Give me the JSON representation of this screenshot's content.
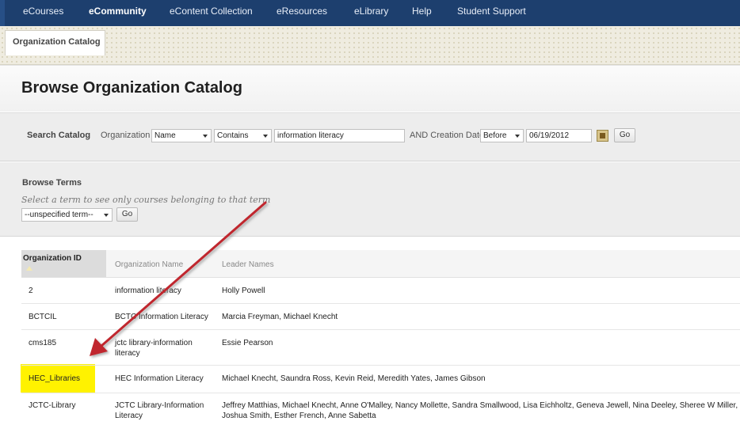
{
  "nav": {
    "tabs": [
      "eCourses",
      "eCommunity",
      "eContent Collection",
      "eResources",
      "eLibrary",
      "Help",
      "Student Support"
    ],
    "active": "eCommunity"
  },
  "breadcrumb": {
    "tab": "Organization Catalog"
  },
  "page_title": "Browse Organization Catalog",
  "search": {
    "label": "Search Catalog",
    "field_label": "Organization",
    "field_select": "Name",
    "operator_select": "Contains",
    "query": "information literacy",
    "date_label": "AND Creation Date",
    "date_operator": "Before",
    "date_value": "06/19/2012",
    "go": "Go"
  },
  "terms": {
    "heading": "Browse Terms",
    "hint": "Select a term to see only courses belonging to that term",
    "select": "--unspecified term--",
    "go": "Go"
  },
  "table": {
    "headers": [
      "Organization ID",
      "Organization Name",
      "Leader Names"
    ],
    "rows": [
      {
        "id": "2",
        "name": "information literacy",
        "leaders": "Holly Powell"
      },
      {
        "id": "BCTCIL",
        "name": "BCTC Information Literacy",
        "leaders": "Marcia Freyman, Michael Knecht"
      },
      {
        "id": "cms185",
        "name": "jctc library-information literacy",
        "leaders": "Essie Pearson"
      },
      {
        "id": "HEC_Libraries",
        "name": "HEC Information Literacy",
        "leaders": "Michael Knecht, Saundra Ross, Kevin Reid, Meredith Yates, James Gibson"
      },
      {
        "id": "JCTC-Library",
        "name": "JCTC Library-Information Literacy",
        "leaders": "Jeffrey Matthias, Michael Knecht, Anne O'Malley, Nancy Mollette, Sandra Smallwood, Lisa Eichholtz, Geneva Jewell, Nina Deeley, Sheree W Miller, Joshua Smith, Esther French, Anne Sabetta"
      }
    ]
  },
  "colors": {
    "nav": "#1d3f6e",
    "highlight": "#fff200",
    "arrow": "#c0282d"
  }
}
